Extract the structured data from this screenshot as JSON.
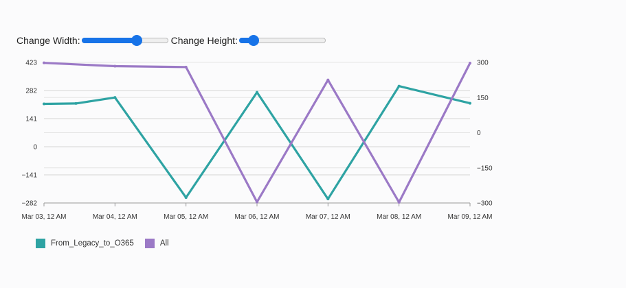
{
  "controls": {
    "width_label": "Change Width:",
    "height_label": "Change Height:",
    "width_value": 0.64,
    "height_value": 0.17
  },
  "chart_data": {
    "type": "line",
    "x": [
      "Mar 03, 12 AM",
      "Mar 04, 12 AM",
      "Mar 05, 12 AM",
      "Mar 06, 12 AM",
      "Mar 07, 12 AM",
      "Mar 08, 12 AM",
      "Mar 09, 12 AM"
    ],
    "left_axis": {
      "ticks": [
        "423",
        "282",
        "141",
        "0",
        "−141",
        "−282"
      ],
      "ylim": [
        -282,
        423
      ]
    },
    "right_axis": {
      "ticks": [
        "300",
        "150",
        "0",
        "−150",
        "−300"
      ],
      "ylim": [
        -300,
        300
      ]
    },
    "grid": true,
    "legend_position": "bottom-left",
    "series": [
      {
        "name": "From_Legacy_to_O365",
        "color": "#2ea3a3",
        "axis": "left",
        "points": [
          [
            0,
            215
          ],
          [
            0.45,
            217
          ],
          [
            1,
            247
          ],
          [
            2,
            -255
          ],
          [
            3,
            273
          ],
          [
            4,
            -262
          ],
          [
            5,
            304
          ],
          [
            6,
            218
          ]
        ]
      },
      {
        "name": "All",
        "color": "#9b79c6",
        "axis": "right",
        "points": [
          [
            0,
            298
          ],
          [
            1,
            284
          ],
          [
            2,
            280
          ],
          [
            3,
            -296
          ],
          [
            4,
            225
          ],
          [
            5,
            -297
          ],
          [
            6,
            297
          ]
        ]
      }
    ]
  }
}
